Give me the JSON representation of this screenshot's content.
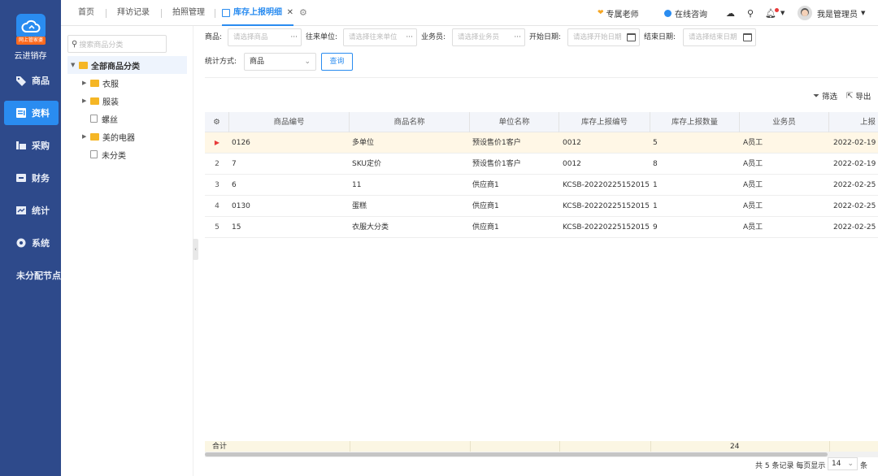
{
  "sidebar": {
    "logo_tag": "网上管家婆",
    "app_name": "云进销存",
    "items": [
      {
        "label": "商品",
        "icon": "tag-icon"
      },
      {
        "label": "资料",
        "icon": "document-icon",
        "active": true
      },
      {
        "label": "采购",
        "icon": "cart-icon"
      },
      {
        "label": "财务",
        "icon": "wallet-icon"
      },
      {
        "label": "统计",
        "icon": "chart-icon"
      },
      {
        "label": "系统",
        "icon": "gear-icon"
      },
      {
        "label": "未分配节点",
        "icon": ""
      }
    ]
  },
  "tabs": [
    {
      "label": "首页"
    },
    {
      "label": "拜访记录"
    },
    {
      "label": "拍照管理"
    },
    {
      "label": "库存上报明细",
      "active": true
    }
  ],
  "topbar": {
    "teacher": "专属老师",
    "consult": "在线咨询",
    "user": "我是管理员"
  },
  "tree": {
    "search_placeholder": "搜索商品分类",
    "root": "全部商品分类",
    "nodes": [
      {
        "label": "衣服",
        "type": "folder",
        "expandable": true
      },
      {
        "label": "服装",
        "type": "folder",
        "expandable": true
      },
      {
        "label": "螺丝",
        "type": "file",
        "expandable": false
      },
      {
        "label": "美的电器",
        "type": "folder",
        "expandable": true
      },
      {
        "label": "未分类",
        "type": "file",
        "expandable": false
      }
    ]
  },
  "filters": {
    "product_label": "商品:",
    "product_placeholder": "请选择商品",
    "partner_label": "往来单位:",
    "partner_placeholder": "请选择往来单位",
    "salesman_label": "业务员:",
    "salesman_placeholder": "请选择业务员",
    "start_label": "开始日期:",
    "start_placeholder": "请选择开始日期",
    "end_label": "结束日期:",
    "end_placeholder": "请选择结束日期",
    "stat_label": "统计方式:",
    "stat_value": "商品",
    "query_label": "查询"
  },
  "actions": {
    "filter_label": "筛选",
    "export_label": "导出"
  },
  "table": {
    "headers": [
      "商品编号",
      "商品名称",
      "单位名称",
      "库存上报编号",
      "库存上报数量",
      "业务员",
      "上报"
    ],
    "rows": [
      {
        "num": "",
        "code": "0126",
        "name": "多单位",
        "unit": "预设售价1客户",
        "report_no": "0012",
        "qty": "5",
        "staff": "A员工",
        "date": "2022-02-19"
      },
      {
        "num": "2",
        "code": "7",
        "name": "SKU定价",
        "unit": "预设售价1客户",
        "report_no": "0012",
        "qty": "8",
        "staff": "A员工",
        "date": "2022-02-19"
      },
      {
        "num": "3",
        "code": "6",
        "name": "11",
        "unit": "供应商1",
        "report_no": "KCSB-20220225152015",
        "qty": "1",
        "staff": "A员工",
        "date": "2022-02-25"
      },
      {
        "num": "4",
        "code": "0130",
        "name": "蛋糕",
        "unit": "供应商1",
        "report_no": "KCSB-20220225152015",
        "qty": "1",
        "staff": "A员工",
        "date": "2022-02-25"
      },
      {
        "num": "5",
        "code": "15",
        "name": "衣服大分类",
        "unit": "供应商1",
        "report_no": "KCSB-20220225152015",
        "qty": "9",
        "staff": "A员工",
        "date": "2022-02-25"
      }
    ],
    "total_label": "合计",
    "total_qty": "24"
  },
  "pager": {
    "summary": "共 5 条记录 每页显示",
    "page_size": "14",
    "unit": "条"
  },
  "colors": {
    "sidebar_bg": "#2e4a8b",
    "accent": "#2a8cf0",
    "highlight_row": "#fff7e6"
  }
}
